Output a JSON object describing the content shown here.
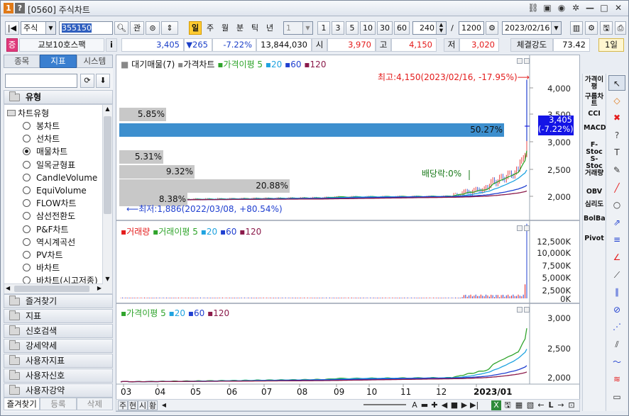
{
  "window": {
    "number_badge": "1",
    "help_badge": "?",
    "title": "[0560] 주식차트",
    "controls": [
      "📎",
      "▭",
      "📷",
      "⚙",
      "—",
      "□",
      "✕"
    ]
  },
  "toolbar": {
    "market": "주식",
    "code": "355150",
    "buttons": {
      "search": "🔍",
      "kwan": "관",
      "tonggye": "통"
    },
    "periods": [
      "일",
      "주",
      "월",
      "분",
      "틱",
      "년"
    ],
    "period_selected": "일",
    "interval_select": "1",
    "quick_counts": [
      "1",
      "3",
      "5",
      "10",
      "30",
      "60"
    ],
    "bar_count": "240",
    "slash": "/",
    "total_count": "1200",
    "date": "2023/02/16",
    "right_btn": "1일"
  },
  "quote": {
    "badge": "증",
    "name": "교보10호스팩",
    "info": "i",
    "price": "3,405",
    "change": "▼265",
    "change_pct": "-7.22%",
    "volume": "13,844,030",
    "open_label": "시",
    "open": "3,970",
    "high_label": "고",
    "high": "4,150",
    "low_label": "저",
    "low": "3,020",
    "strength_label": "체결강도",
    "strength": "73.42"
  },
  "left": {
    "tabs": [
      "종목",
      "지표",
      "시스템"
    ],
    "active_tab": "지표",
    "btn_refresh": "⟳",
    "btn_download": "⬇",
    "group_type": "유형",
    "tree_root": "차트유형",
    "chart_types": [
      "봉차트",
      "선차트",
      "매물차트",
      "일목균형표",
      "CandleVolume",
      "EquiVolume",
      "FLOW차트",
      "삼선전환도",
      "P&F차트",
      "역시계곡선",
      "PV차트",
      "바차트",
      "바차트(시고저종)"
    ],
    "selected_type": "매물차트",
    "groups": [
      "즐겨찾기",
      "지표",
      "신호검색",
      "강세약세",
      "사용자지표",
      "사용자신호",
      "사용자강약"
    ],
    "bottom_tabs": [
      "즐겨찾기",
      "등록",
      "삭제"
    ]
  },
  "chart": {
    "price_legend": [
      "대기매물(7)",
      "가격차트",
      "가격이평 5",
      "20",
      "60",
      "120"
    ],
    "volume_legend": [
      "거래량",
      "거래이평 5",
      "20",
      "60",
      "120"
    ],
    "ma_legend": [
      "가격이평 5",
      "20",
      "60",
      "120"
    ],
    "price_axis": [
      "4,000",
      "3,500",
      "3,000",
      "2,500",
      "2,000"
    ],
    "current_price_tag": [
      "3,405",
      "(-7.22%)"
    ],
    "volume_axis": [
      "12,500K",
      "10,000K",
      "7,500K",
      "5,000K",
      "2,500K",
      "0K"
    ],
    "ma_axis": [
      "3,000",
      "2,500",
      "2,000"
    ],
    "x_labels": [
      "03",
      "04",
      "05",
      "06",
      "07",
      "08",
      "09",
      "10",
      "11",
      "12",
      "2023/01"
    ],
    "high_annotation": "최고:4,150(2023/02/16, -17.95%)⟶",
    "low_annotation": "⟵최저:1,886(2022/03/08, +80.54%)",
    "dividend_annotation": "배당락:0%",
    "volume_profile": [
      "5.85%",
      "50.27%",
      "5.31%",
      "9.32%",
      "20.88%",
      "8.38%"
    ],
    "colors": {
      "red": "#e41c1c",
      "green": "#2fa42b",
      "blue": "#1f3fd0",
      "darkblue": "#1b1b7a",
      "price": "#3d8fce"
    }
  },
  "right_tools": {
    "col1": [
      "가격이평",
      "구름차트",
      "CCI",
      "MACD",
      "F-Stoc",
      "S-Stoc",
      "거래량",
      "OBV",
      "심리도",
      "BolBand",
      "Pivot"
    ],
    "col2_icons": [
      "cursor-icon",
      "eraser-icon",
      "delete-icon",
      "question-icon",
      "text-icon",
      "paint-icon",
      "line-icon",
      "circle-icon",
      "fib-icon",
      "channel-icon",
      "gann-icon",
      "ray-icon",
      "parallel-icon",
      "cycle-icon",
      "fan-icon",
      "pitchfork-icon",
      "wave-icon",
      "auto-icon",
      "window-icon"
    ]
  },
  "bottom_strip": {
    "items": [
      "주",
      "현",
      "시",
      "황"
    ],
    "zoom_label": "A"
  }
}
